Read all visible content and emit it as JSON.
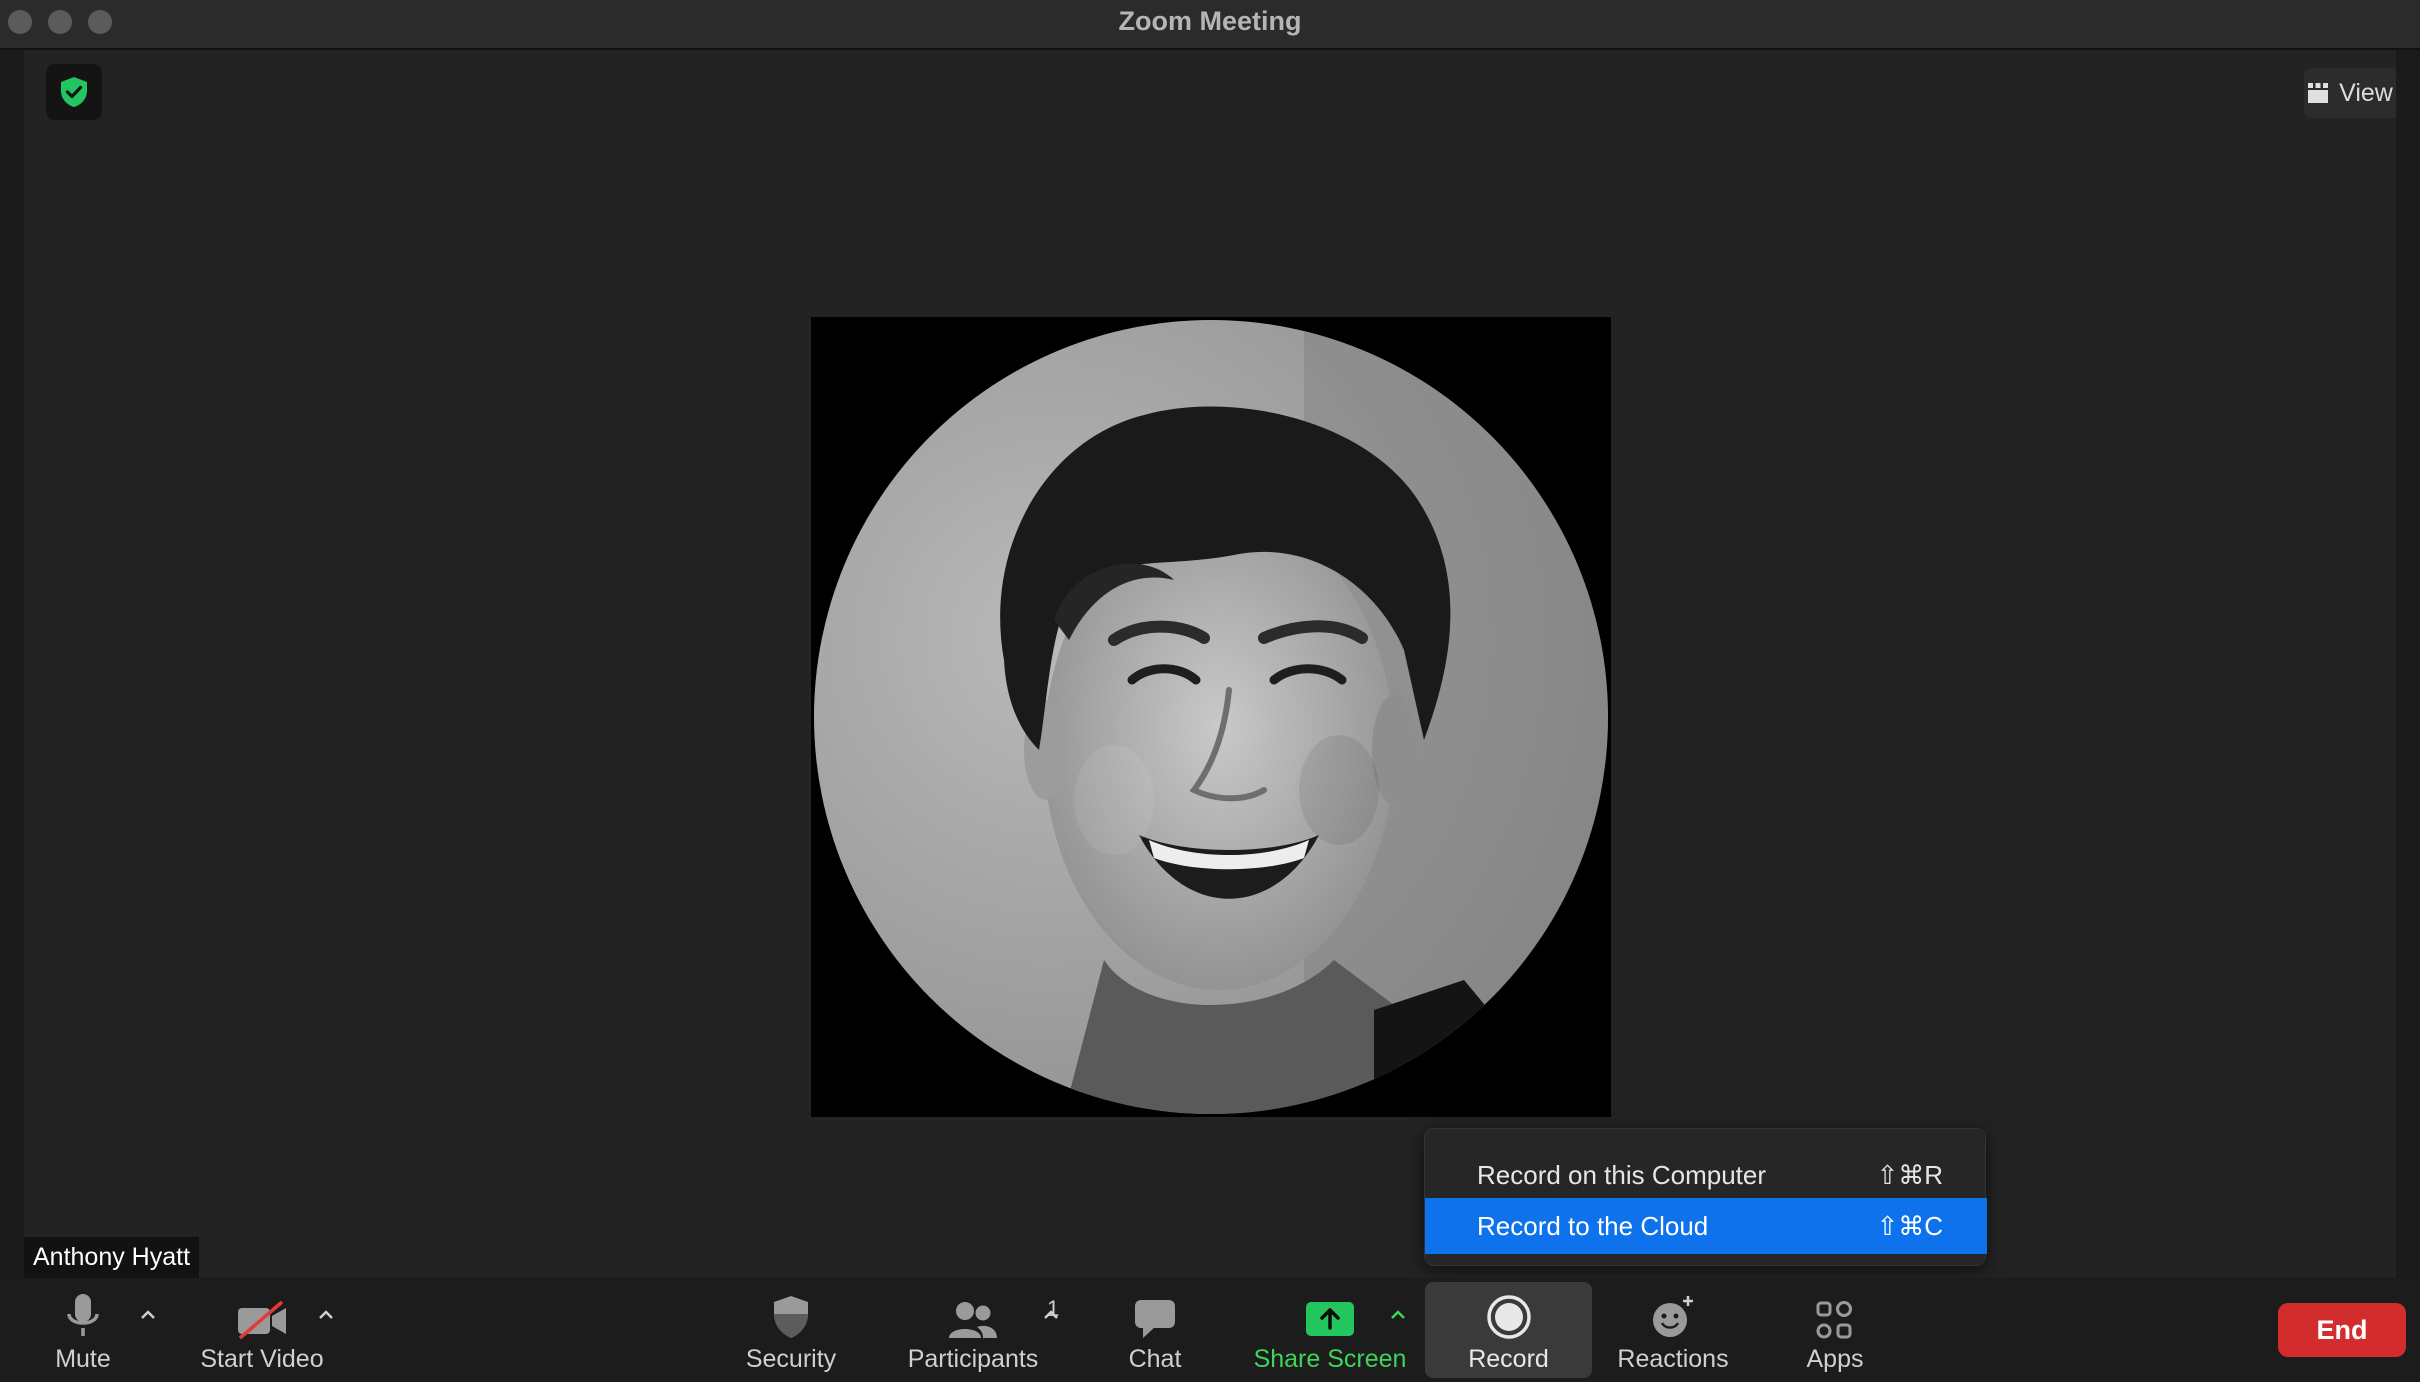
{
  "window": {
    "title": "Zoom Meeting"
  },
  "top_bar": {
    "view_label": "View"
  },
  "participant": {
    "name": "Anthony Hyatt"
  },
  "toolbar": {
    "mute": "Mute",
    "start_video": "Start Video",
    "security": "Security",
    "participants": "Participants",
    "participant_count": "1",
    "chat": "Chat",
    "share_screen": "Share Screen",
    "record": "Record",
    "reactions": "Reactions",
    "apps": "Apps",
    "end": "End"
  },
  "record_menu": {
    "items": [
      {
        "label": "Record on this Computer",
        "shortcut": "⇧⌘R",
        "selected": false
      },
      {
        "label": "Record to the Cloud",
        "shortcut": "⇧⌘C",
        "selected": true
      }
    ]
  },
  "colors": {
    "accent_blue": "#0e72ed",
    "share_green": "#3fd35a",
    "end_red": "#d22c2c",
    "security_green": "#22c55e"
  },
  "icons": [
    "shield-check-icon",
    "grid-view-icon",
    "microphone-icon",
    "video-off-icon",
    "shield-icon",
    "participants-icon",
    "chat-icon",
    "share-screen-icon",
    "record-icon",
    "reactions-icon",
    "apps-icon",
    "chevron-up-icon"
  ]
}
